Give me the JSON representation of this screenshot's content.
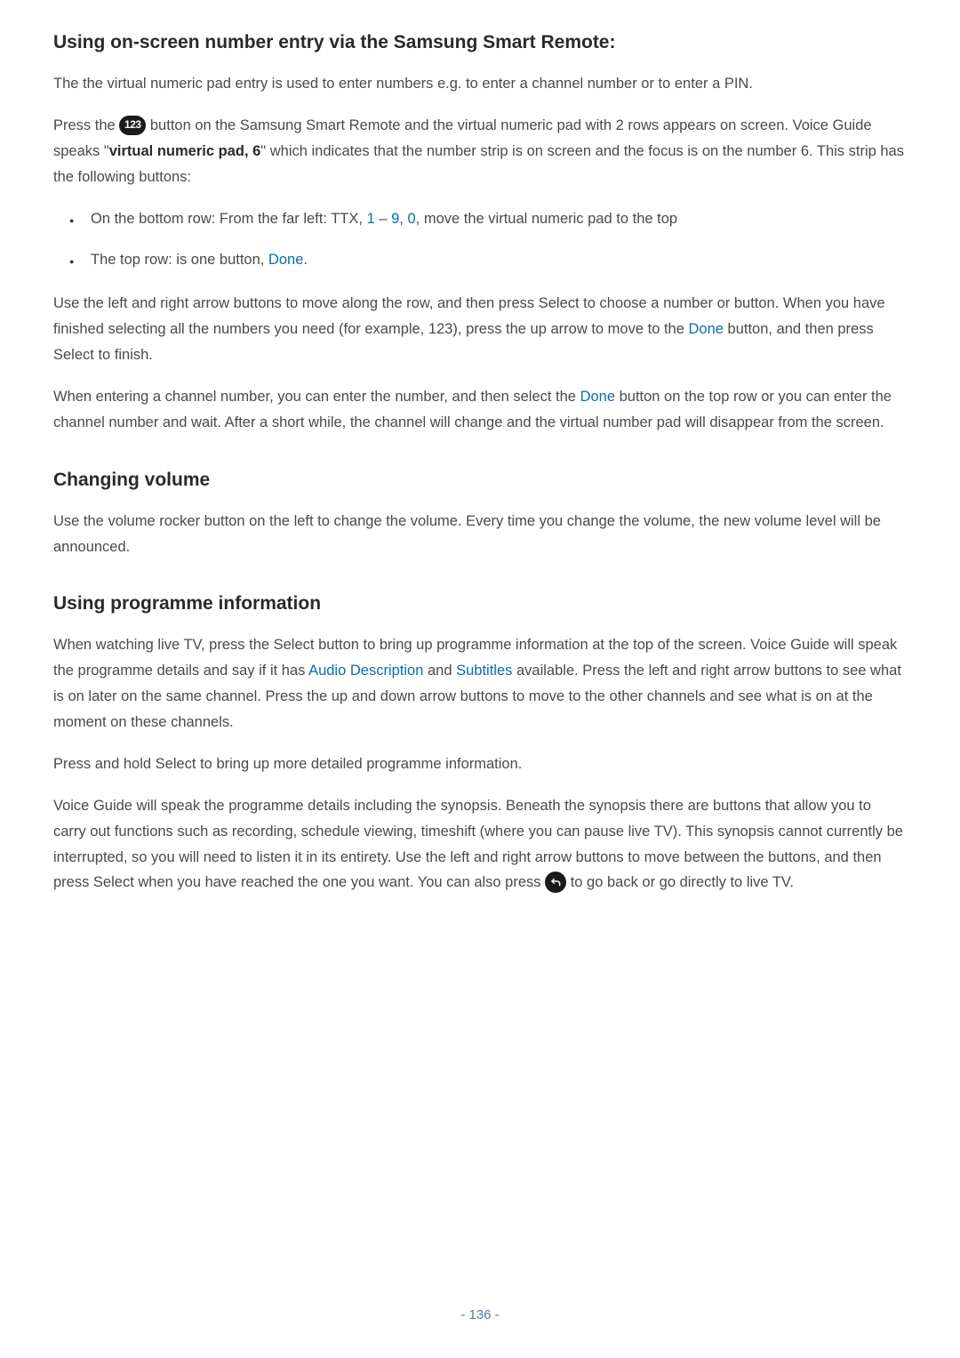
{
  "sections": {
    "s1": {
      "heading": "Using on-screen number entry via the Samsung Smart Remote:",
      "p1": "The the virtual numeric pad entry is used to enter numbers e.g. to enter a channel number or to enter a PIN.",
      "p2a": "Press the ",
      "icon123": "123",
      "p2b": " button on the Samsung Smart Remote and the virtual numeric pad with 2 rows appears on screen. Voice Guide speaks \"",
      "p2bold": "virtual numeric pad, 6",
      "p2c": "\" which indicates that the number strip is on screen and the focus is on the number 6. This strip has the following buttons:",
      "li1a": "On the bottom row: From the far left: TTX, ",
      "li1blue1": "1",
      "li1mid": " – ",
      "li1blue2": "9",
      "li1comma": ", ",
      "li1blue3": "0",
      "li1b": ", move the virtual numeric pad to the top",
      "li2a": "The top row: is one button, ",
      "li2blue": "Done",
      "li2b": ".",
      "p3a": "Use the left and right arrow buttons to move along the row, and then press Select to choose a number or button. When you have finished selecting all the numbers you need (for example, 123), press the up arrow to move to the ",
      "p3blue": "Done",
      "p3b": " button, and then press Select to finish.",
      "p4a": "When entering a channel number, you can enter the number, and then select the ",
      "p4blue": "Done",
      "p4b": " button on the top row or you can enter the channel number and wait. After a short while, the channel will change and the virtual number pad will disappear from the screen."
    },
    "s2": {
      "heading": "Changing volume",
      "p1": "Use the volume rocker button on the left to change the volume. Every time you change the volume, the new volume level will be announced."
    },
    "s3": {
      "heading": "Using programme information",
      "p1a": "When watching live TV, press the Select button to bring up programme information at the top of the screen. Voice Guide will speak the programme details and say if it has ",
      "p1blue1": "Audio Description",
      "p1mid": " and ",
      "p1blue2": "Subtitles",
      "p1b": " available. Press the left and right arrow buttons to see what is on later on the same channel. Press the up and down arrow buttons to move to the other channels and see what is on at the moment on these channels.",
      "p2": "Press and hold Select to bring up more detailed programme information.",
      "p3a": "Voice Guide will speak the programme details including the synopsis. Beneath the synopsis there are buttons that allow you to carry out functions such as recording, schedule viewing, timeshift (where you can pause live TV). This synopsis cannot currently be interrupted, so you will need to listen it in its entirety. Use the left and right arrow buttons to move between the buttons, and then press Select when you have reached the one you want. You can also press ",
      "p3b": " to go back or go directly to live TV."
    }
  },
  "pageNumber": "- 136 -"
}
